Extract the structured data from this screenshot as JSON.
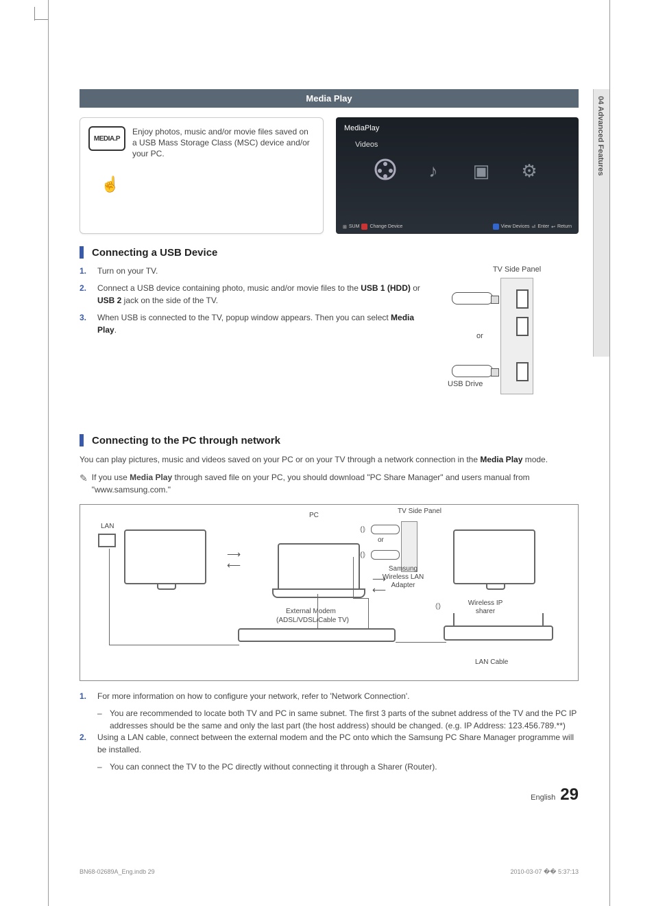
{
  "sidebar": {
    "label": "04   Advanced Features"
  },
  "section_title": "Media Play",
  "intro": {
    "button_label": "MEDIA.P",
    "text": "Enjoy photos, music and/or movie files saved on a USB Mass Storage Class (MSC) device and/or your PC."
  },
  "tv_preview": {
    "title": "MediaPlay",
    "subtitle": "Videos",
    "footer_left": {
      "sum": "SUM",
      "a": "Change Device"
    },
    "footer_right": {
      "d": "View Devices",
      "enter": "Enter",
      "return": "Return"
    }
  },
  "usb_section": {
    "heading": "Connecting a USB Device",
    "panel_label": "TV Side Panel",
    "or_label": "or",
    "drive_label": "USB Drive",
    "steps": [
      {
        "num": "1.",
        "text": "Turn on your TV."
      },
      {
        "num": "2.",
        "html": "Connect a USB device containing photo, music and/or movie files to the <b>USB 1 (HDD)</b> or <b>USB 2</b> jack on the side of the TV."
      },
      {
        "num": "3.",
        "html": "When USB is connected to the TV, popup window appears. Then you can select <b>Media Play</b>."
      }
    ]
  },
  "pc_section": {
    "heading": "Connecting to the PC through network",
    "intro_html": "You can play pictures, music and videos saved on your PC or on your TV through a network connection in the <b>Media Play</b> mode.",
    "note_html": "If you use <b>Media Play</b> through saved file on your PC, you should download \"PC Share Manager\" and users manual from \"www.samsung.com.\"",
    "diagram": {
      "lan": "LAN",
      "pc": "PC",
      "tv_side_panel": "TV Side Panel",
      "or": "or",
      "samsung_adapter": "Samsung Wireless LAN Adapter",
      "external_modem": "External Modem",
      "modem_sub": "(ADSL/VDSL/Cable TV)",
      "wireless_ip": "Wireless IP sharer",
      "lan_cable": "LAN Cable"
    },
    "steps": [
      {
        "num": "1.",
        "text": "For more information on how to configure your network, refer to 'Network Connection'.",
        "subs": [
          "You are recommended to locate both TV and PC in same subnet. The first 3 parts of the subnet address of the TV and the PC IP addresses should be the same and only the last part (the host address) should be changed. (e.g. IP Address: 123.456.789.**)"
        ]
      },
      {
        "num": "2.",
        "text": "Using a LAN cable, connect between the external modem and the PC onto which the Samsung PC Share Manager programme will be installed.",
        "subs": [
          "You can connect the TV to the PC directly without connecting it through a Sharer (Router)."
        ]
      }
    ]
  },
  "page_footer": {
    "lang": "English",
    "num": "29"
  },
  "doc_footer": {
    "left": "BN68-02689A_Eng.indb   29",
    "right": "2010-03-07   �� 5:37:13"
  }
}
